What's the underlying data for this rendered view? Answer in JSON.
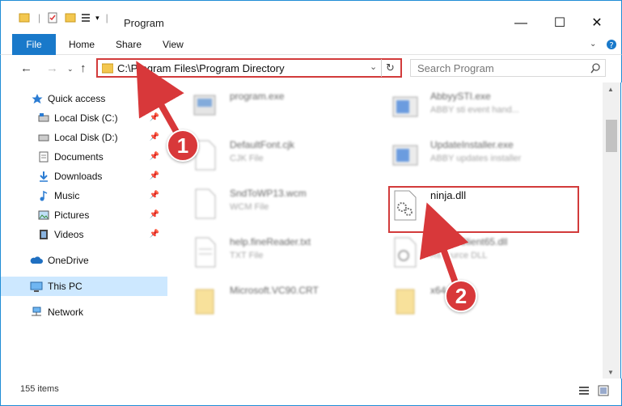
{
  "window": {
    "title": "Program",
    "minimize": "—",
    "maximize": "☐",
    "close": "✕"
  },
  "ribbon": {
    "tabs": [
      {
        "label": "File"
      },
      {
        "label": "Home"
      },
      {
        "label": "Share"
      },
      {
        "label": "View"
      }
    ]
  },
  "nav": {
    "address": "C:\\Program Files\\Program Directory",
    "search_placeholder": "Search Program"
  },
  "sidebar": {
    "items": [
      {
        "label": "Quick access"
      },
      {
        "label": "Local Disk (C:)"
      },
      {
        "label": "Local Disk (D:)"
      },
      {
        "label": "Documents"
      },
      {
        "label": "Downloads"
      },
      {
        "label": "Music"
      },
      {
        "label": "Pictures"
      },
      {
        "label": "Videos"
      },
      {
        "label": "OneDrive"
      },
      {
        "label": "This PC"
      },
      {
        "label": "Network"
      }
    ]
  },
  "files": [
    {
      "name": "program.exe",
      "type": ""
    },
    {
      "name": "AbbyySTI.exe",
      "type": "ABBY sti event hand..."
    },
    {
      "name": "DefaultFont.cjk",
      "type": "CJK File"
    },
    {
      "name": "UpdateInstaller.exe",
      "type": "ABBY updates installer"
    },
    {
      "name": "SndToWP13.wcm",
      "type": "WCM File"
    },
    {
      "name": "ninja.dll",
      "type": ""
    },
    {
      "name": "help.fineReader.txt",
      "type": "TXT File"
    },
    {
      "name": "CreateClient65.dll",
      "type": "Resource DLL"
    },
    {
      "name": "Microsoft.VC90.CRT",
      "type": ""
    },
    {
      "name": "x64",
      "type": ""
    }
  ],
  "status": {
    "count": "155 items"
  },
  "annotations": {
    "step1": "1",
    "step2": "2"
  },
  "colors": {
    "accent": "#1979ca",
    "highlight": "#d23b3b",
    "selected": "#cde8ff"
  }
}
